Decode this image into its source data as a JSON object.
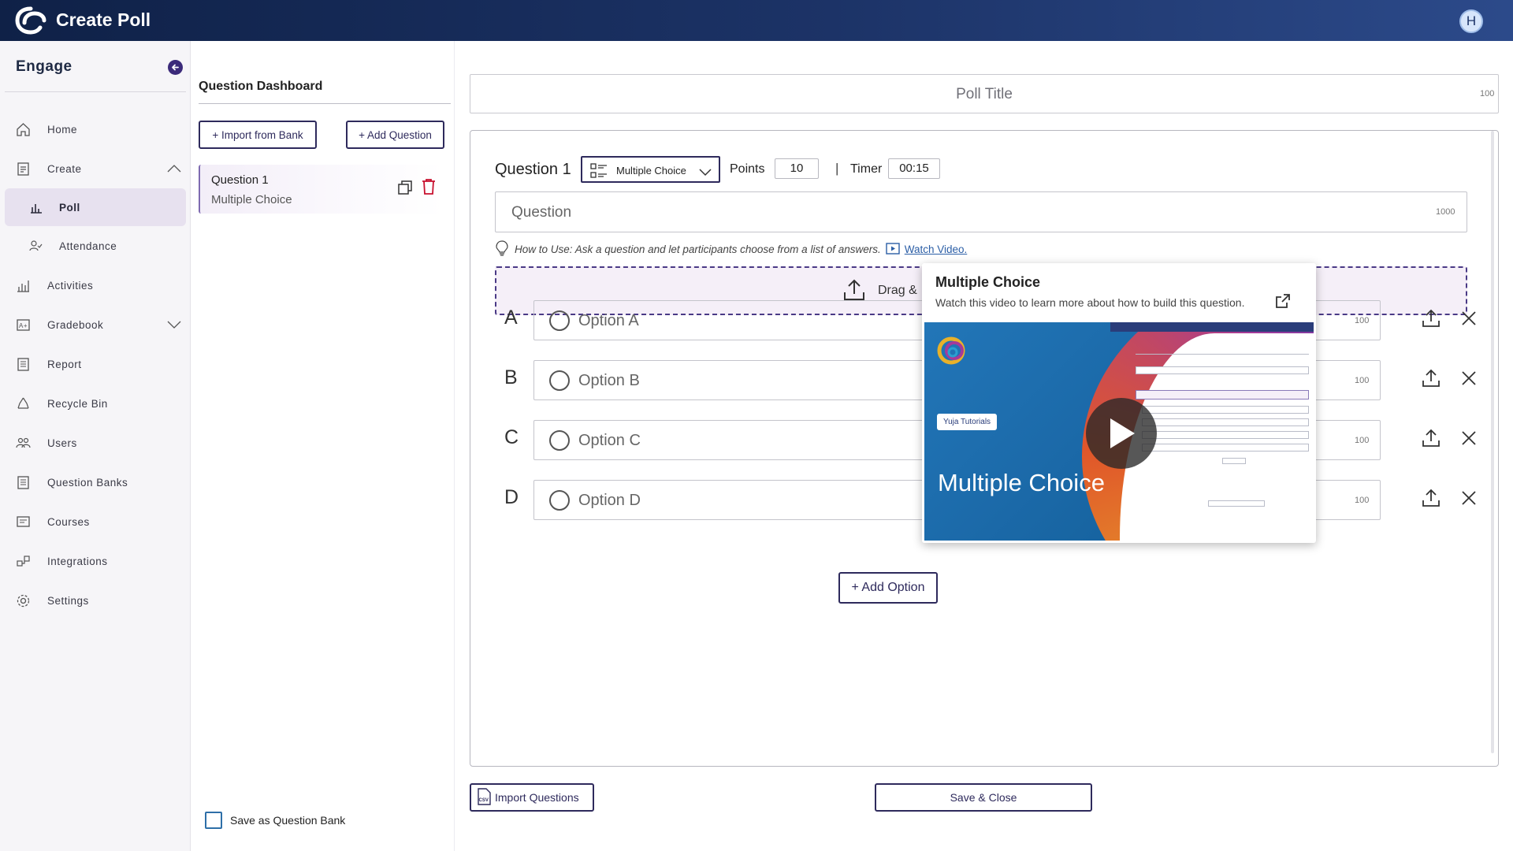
{
  "topbar": {
    "title": "Create Poll",
    "avatar_initial": "H"
  },
  "nav": {
    "brand": "Engage",
    "items": [
      {
        "label": "Home",
        "icon": "home-icon"
      },
      {
        "label": "Create",
        "icon": "create-icon"
      },
      {
        "label": "Poll",
        "icon": "poll-icon"
      },
      {
        "label": "Attendance",
        "icon": "attendance-icon"
      },
      {
        "label": "Activities",
        "icon": "activities-icon"
      },
      {
        "label": "Gradebook",
        "icon": "gradebook-icon"
      },
      {
        "label": "Report",
        "icon": "report-icon"
      },
      {
        "label": "Recycle Bin",
        "icon": "recycle-icon"
      },
      {
        "label": "Users",
        "icon": "users-icon"
      },
      {
        "label": "Question Banks",
        "icon": "question-banks-icon"
      },
      {
        "label": "Courses",
        "icon": "courses-icon"
      },
      {
        "label": "Integrations",
        "icon": "integrations-icon"
      },
      {
        "label": "Settings",
        "icon": "settings-icon"
      }
    ]
  },
  "dashboard": {
    "title": "Question Dashboard",
    "import_label": "+ Import from Bank",
    "add_label": "+ Add Question",
    "question": {
      "name": "Question 1",
      "type": "Multiple Choice"
    },
    "save_bank_label": "Save as Question Bank"
  },
  "poll": {
    "title_placeholder": "Poll Title",
    "title_limit": "100",
    "question_label": "Question 1",
    "type_value": "Multiple Choice",
    "points_label": "Points",
    "points_value": "10",
    "separator": "|",
    "timer_label": "Timer",
    "timer_value": "00:15",
    "question_placeholder": "Question",
    "question_limit": "1000",
    "howto_text": "How to Use: Ask a question and let participants choose from a list of answers.",
    "watch_link": "Watch Video.",
    "drop_text": "Drag &",
    "options": [
      {
        "letter": "A",
        "placeholder": "Option A",
        "limit": "100"
      },
      {
        "letter": "B",
        "placeholder": "Option B",
        "limit": "100"
      },
      {
        "letter": "C",
        "placeholder": "Option C",
        "limit": "100"
      },
      {
        "letter": "D",
        "placeholder": "Option D",
        "limit": "100"
      }
    ],
    "add_option_label": "+ Add Option",
    "import_questions_label": "Import Questions",
    "save_close_label": "Save & Close"
  },
  "popover": {
    "title": "Multiple Choice",
    "description": "Watch this video to learn more about how to build this question.",
    "video_badge": "Yuja Tutorials",
    "video_title": "Multiple Choice"
  },
  "colors": {
    "accent": "#2e2a5c",
    "topbar": "#1c3367",
    "link": "#2b5ea6",
    "delete": "#c8102e"
  }
}
